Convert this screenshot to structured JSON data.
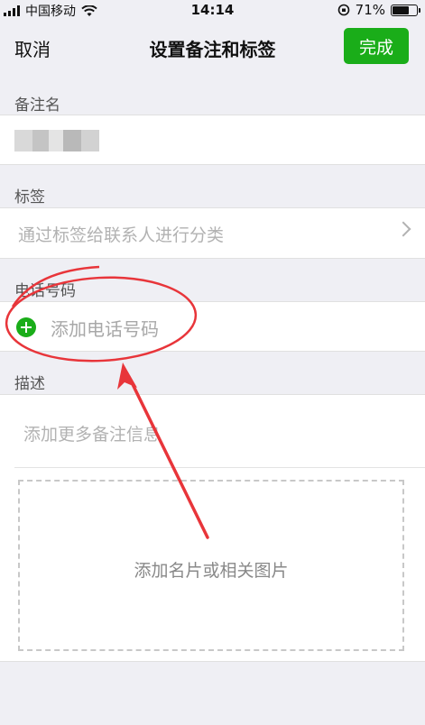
{
  "status_bar": {
    "carrier": "中国移动",
    "time": "14:14",
    "battery": "71%",
    "battery_level": 0.71
  },
  "nav": {
    "cancel": "取消",
    "title": "设置备注和标签",
    "done": "完成"
  },
  "remark": {
    "label": "备注名"
  },
  "tags": {
    "label": "标签",
    "placeholder": "通过标签给联系人进行分类"
  },
  "phone": {
    "label": "电话号码",
    "add": "添加电话号码"
  },
  "description": {
    "label": "描述",
    "placeholder": "添加更多备注信息",
    "photo": "添加名片或相关图片"
  },
  "colors": {
    "accent": "#1aad19",
    "annotation": "#e8353a"
  }
}
